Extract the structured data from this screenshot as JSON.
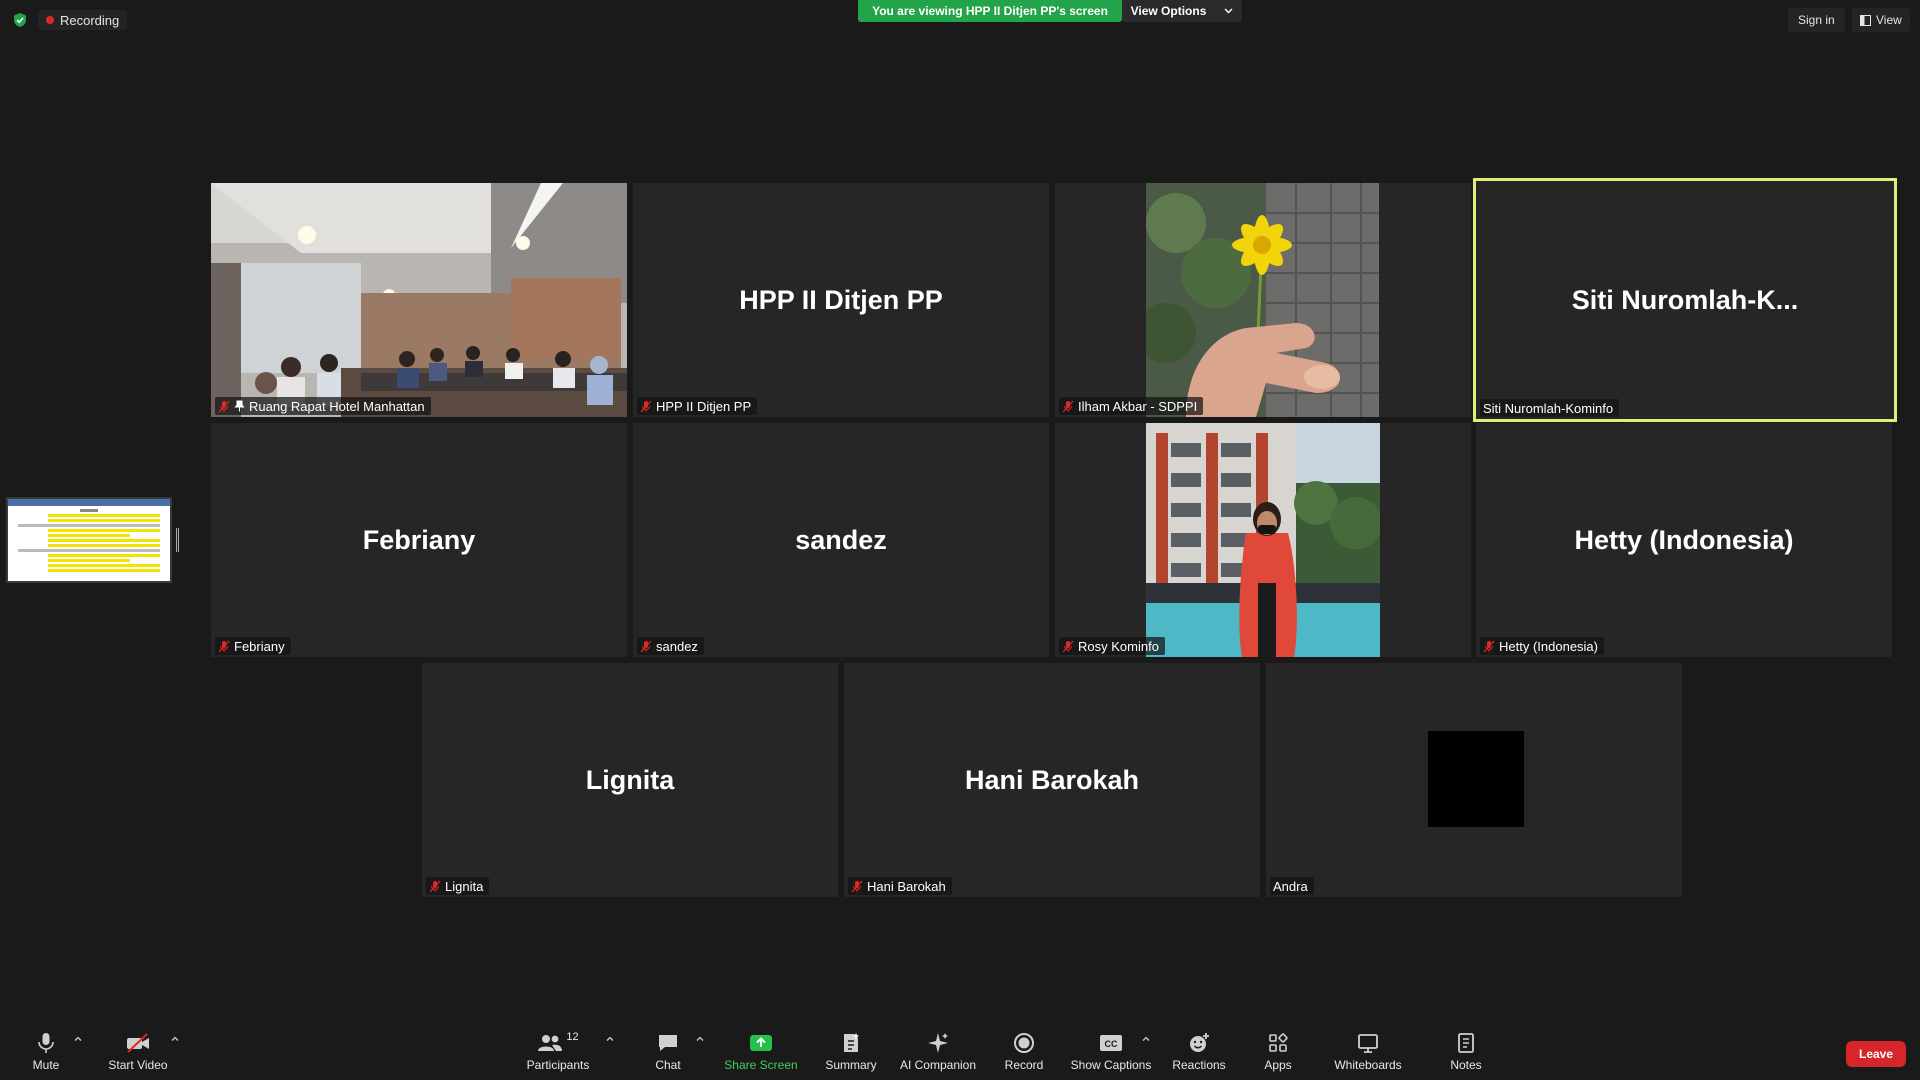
{
  "topbar": {
    "recording_label": "Recording",
    "viewing_banner": "You are viewing HPP II Ditjen PP's screen",
    "view_options_label": "View Options",
    "sign_in_label": "Sign in",
    "view_label": "View"
  },
  "colors": {
    "background": "#1a1a1a",
    "tile": "#262626",
    "banner_green": "#23a34a",
    "active_speaker_border": "#e1ed77",
    "recording_dot": "#e02828",
    "leave_red": "#d6262a",
    "share_green": "#3fcf63"
  },
  "tiles": [
    {
      "big_name": "",
      "label": "Ruang Rapat Hotel Manhattan",
      "muted": true,
      "pinned": true,
      "video": "meeting-room"
    },
    {
      "big_name": "HPP II Ditjen PP",
      "label": "HPP II Ditjen PP",
      "muted": true,
      "pinned": false,
      "video": "none"
    },
    {
      "big_name": "",
      "label": "Ilham Akbar - SDPPI",
      "muted": true,
      "pinned": false,
      "video": "flower"
    },
    {
      "big_name": "Siti  Nuromlah-K...",
      "label": "Siti Nuromlah-Kominfo",
      "muted": false,
      "pinned": false,
      "video": "none",
      "active": true
    },
    {
      "big_name": "Febriany",
      "label": "Febriany",
      "muted": true,
      "pinned": false,
      "video": "none"
    },
    {
      "big_name": "sandez",
      "label": "sandez",
      "muted": true,
      "pinned": false,
      "video": "none"
    },
    {
      "big_name": "",
      "label": "Rosy Kominfo",
      "muted": true,
      "pinned": false,
      "video": "hotel-person"
    },
    {
      "big_name": "Hetty (Indonesia)",
      "label": "Hetty (Indonesia)",
      "muted": true,
      "pinned": false,
      "video": "none"
    },
    {
      "big_name": "Lignita",
      "label": "Lignita",
      "muted": true,
      "pinned": false,
      "video": "none"
    },
    {
      "big_name": "Hani Barokah",
      "label": "Hani Barokah",
      "muted": true,
      "pinned": false,
      "video": "none"
    },
    {
      "big_name": "",
      "label": "Andra",
      "muted": false,
      "pinned": false,
      "video": "black"
    }
  ],
  "toolbar": {
    "mute": "Mute",
    "start_video": "Start Video",
    "participants": "Participants",
    "participants_count": "12",
    "chat": "Chat",
    "share_screen": "Share Screen",
    "summary": "Summary",
    "ai_companion": "AI Companion",
    "record": "Record",
    "show_captions": "Show Captions",
    "captions_icon_text": "CC",
    "reactions": "Reactions",
    "apps": "Apps",
    "whiteboards": "Whiteboards",
    "notes": "Notes",
    "leave": "Leave"
  }
}
